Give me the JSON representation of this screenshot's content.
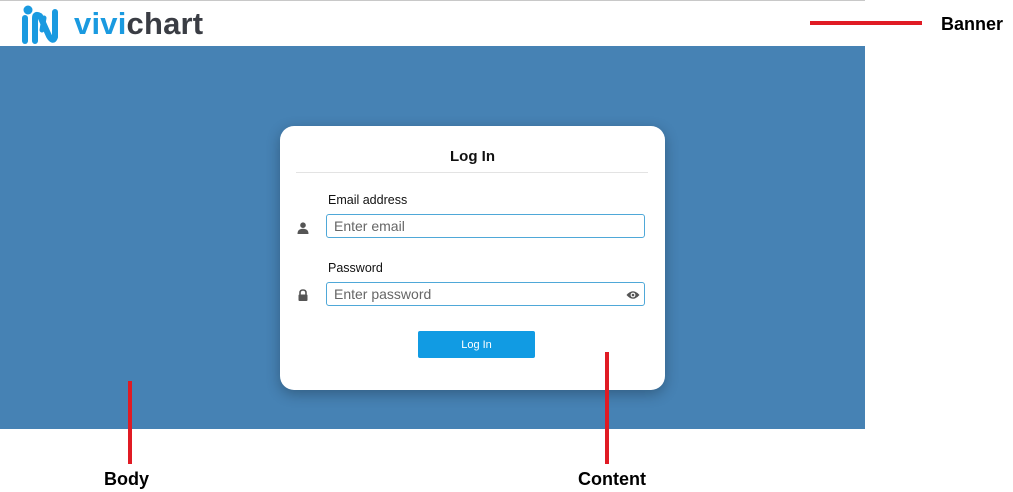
{
  "brand": {
    "name_part1": "vivi",
    "name_part2": "chart",
    "color_primary": "#1a9ae0",
    "color_dark": "#3a3d44"
  },
  "body": {
    "background": "#4682b4"
  },
  "login": {
    "title": "Log In",
    "email": {
      "label": "Email address",
      "placeholder": "Enter email",
      "value": "",
      "icon": "user-icon"
    },
    "password": {
      "label": "Password",
      "placeholder": "Enter password",
      "value": "",
      "icon": "lock-icon",
      "toggle_icon": "eye-icon"
    },
    "submit_label": "Log In",
    "button_color": "#119be3"
  },
  "annotations": {
    "color": "#e01b24",
    "banner": "Banner",
    "body": "Body",
    "content": "Content"
  }
}
